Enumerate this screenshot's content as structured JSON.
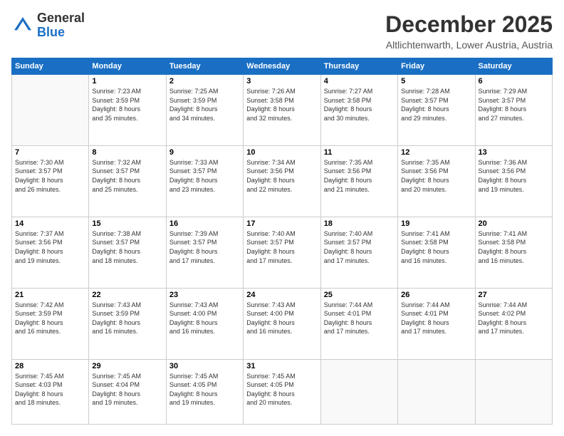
{
  "logo": {
    "general": "General",
    "blue": "Blue"
  },
  "header": {
    "month": "December 2025",
    "location": "Altlichtenwarth, Lower Austria, Austria"
  },
  "weekdays": [
    "Sunday",
    "Monday",
    "Tuesday",
    "Wednesday",
    "Thursday",
    "Friday",
    "Saturday"
  ],
  "weeks": [
    [
      {
        "day": "",
        "info": ""
      },
      {
        "day": "1",
        "info": "Sunrise: 7:23 AM\nSunset: 3:59 PM\nDaylight: 8 hours\nand 35 minutes."
      },
      {
        "day": "2",
        "info": "Sunrise: 7:25 AM\nSunset: 3:59 PM\nDaylight: 8 hours\nand 34 minutes."
      },
      {
        "day": "3",
        "info": "Sunrise: 7:26 AM\nSunset: 3:58 PM\nDaylight: 8 hours\nand 32 minutes."
      },
      {
        "day": "4",
        "info": "Sunrise: 7:27 AM\nSunset: 3:58 PM\nDaylight: 8 hours\nand 30 minutes."
      },
      {
        "day": "5",
        "info": "Sunrise: 7:28 AM\nSunset: 3:57 PM\nDaylight: 8 hours\nand 29 minutes."
      },
      {
        "day": "6",
        "info": "Sunrise: 7:29 AM\nSunset: 3:57 PM\nDaylight: 8 hours\nand 27 minutes."
      }
    ],
    [
      {
        "day": "7",
        "info": "Sunrise: 7:30 AM\nSunset: 3:57 PM\nDaylight: 8 hours\nand 26 minutes."
      },
      {
        "day": "8",
        "info": "Sunrise: 7:32 AM\nSunset: 3:57 PM\nDaylight: 8 hours\nand 25 minutes."
      },
      {
        "day": "9",
        "info": "Sunrise: 7:33 AM\nSunset: 3:57 PM\nDaylight: 8 hours\nand 23 minutes."
      },
      {
        "day": "10",
        "info": "Sunrise: 7:34 AM\nSunset: 3:56 PM\nDaylight: 8 hours\nand 22 minutes."
      },
      {
        "day": "11",
        "info": "Sunrise: 7:35 AM\nSunset: 3:56 PM\nDaylight: 8 hours\nand 21 minutes."
      },
      {
        "day": "12",
        "info": "Sunrise: 7:35 AM\nSunset: 3:56 PM\nDaylight: 8 hours\nand 20 minutes."
      },
      {
        "day": "13",
        "info": "Sunrise: 7:36 AM\nSunset: 3:56 PM\nDaylight: 8 hours\nand 19 minutes."
      }
    ],
    [
      {
        "day": "14",
        "info": "Sunrise: 7:37 AM\nSunset: 3:56 PM\nDaylight: 8 hours\nand 19 minutes."
      },
      {
        "day": "15",
        "info": "Sunrise: 7:38 AM\nSunset: 3:57 PM\nDaylight: 8 hours\nand 18 minutes."
      },
      {
        "day": "16",
        "info": "Sunrise: 7:39 AM\nSunset: 3:57 PM\nDaylight: 8 hours\nand 17 minutes."
      },
      {
        "day": "17",
        "info": "Sunrise: 7:40 AM\nSunset: 3:57 PM\nDaylight: 8 hours\nand 17 minutes."
      },
      {
        "day": "18",
        "info": "Sunrise: 7:40 AM\nSunset: 3:57 PM\nDaylight: 8 hours\nand 17 minutes."
      },
      {
        "day": "19",
        "info": "Sunrise: 7:41 AM\nSunset: 3:58 PM\nDaylight: 8 hours\nand 16 minutes."
      },
      {
        "day": "20",
        "info": "Sunrise: 7:41 AM\nSunset: 3:58 PM\nDaylight: 8 hours\nand 16 minutes."
      }
    ],
    [
      {
        "day": "21",
        "info": "Sunrise: 7:42 AM\nSunset: 3:59 PM\nDaylight: 8 hours\nand 16 minutes."
      },
      {
        "day": "22",
        "info": "Sunrise: 7:43 AM\nSunset: 3:59 PM\nDaylight: 8 hours\nand 16 minutes."
      },
      {
        "day": "23",
        "info": "Sunrise: 7:43 AM\nSunset: 4:00 PM\nDaylight: 8 hours\nand 16 minutes."
      },
      {
        "day": "24",
        "info": "Sunrise: 7:43 AM\nSunset: 4:00 PM\nDaylight: 8 hours\nand 16 minutes."
      },
      {
        "day": "25",
        "info": "Sunrise: 7:44 AM\nSunset: 4:01 PM\nDaylight: 8 hours\nand 17 minutes."
      },
      {
        "day": "26",
        "info": "Sunrise: 7:44 AM\nSunset: 4:01 PM\nDaylight: 8 hours\nand 17 minutes."
      },
      {
        "day": "27",
        "info": "Sunrise: 7:44 AM\nSunset: 4:02 PM\nDaylight: 8 hours\nand 17 minutes."
      }
    ],
    [
      {
        "day": "28",
        "info": "Sunrise: 7:45 AM\nSunset: 4:03 PM\nDaylight: 8 hours\nand 18 minutes."
      },
      {
        "day": "29",
        "info": "Sunrise: 7:45 AM\nSunset: 4:04 PM\nDaylight: 8 hours\nand 19 minutes."
      },
      {
        "day": "30",
        "info": "Sunrise: 7:45 AM\nSunset: 4:05 PM\nDaylight: 8 hours\nand 19 minutes."
      },
      {
        "day": "31",
        "info": "Sunrise: 7:45 AM\nSunset: 4:05 PM\nDaylight: 8 hours\nand 20 minutes."
      },
      {
        "day": "",
        "info": ""
      },
      {
        "day": "",
        "info": ""
      },
      {
        "day": "",
        "info": ""
      }
    ]
  ]
}
